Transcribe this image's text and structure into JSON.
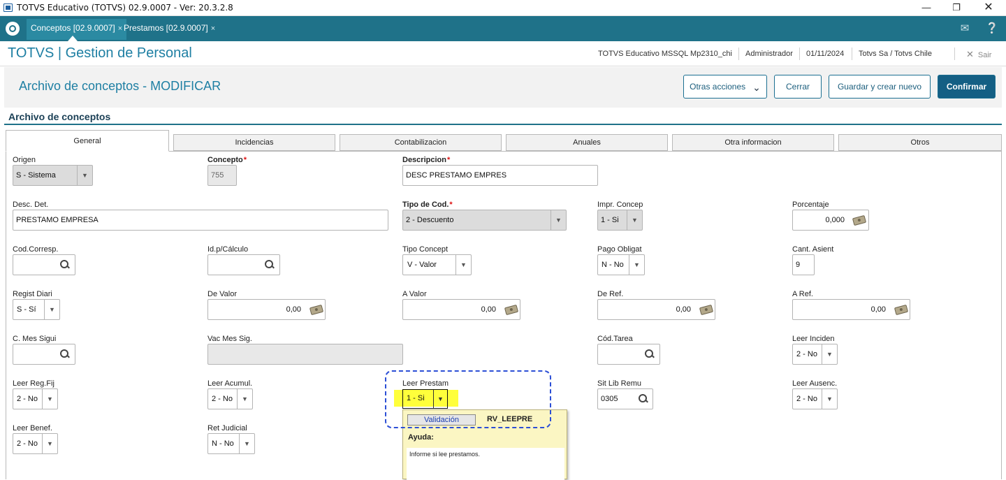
{
  "window": {
    "title": "TOTVS Educativo (TOTVS) 02.9.0007 - Ver: 20.3.2.8"
  },
  "tabs": [
    {
      "label": "Conceptos [02.9.0007]",
      "close": "×"
    },
    {
      "label": "Prestamos [02.9.0007]",
      "close": "×"
    }
  ],
  "app": {
    "title": "TOTVS | Gestion de Personal",
    "environment": "TOTVS Educativo MSSQL Mp2310_chi",
    "user": "Administrador",
    "date": "01/11/2024",
    "company": "Totvs Sa / Totvs Chile",
    "exit_label": "Sair"
  },
  "page": {
    "title": "Archivo de conceptos - MODIFICAR",
    "buttons": {
      "more_actions": "Otras acciones",
      "close": "Cerrar",
      "save_new": "Guardar y crear nuevo",
      "confirm": "Confirmar"
    },
    "section_title": "Archivo de conceptos"
  },
  "folders": [
    "General",
    "Incidencias",
    "Contabilizacion",
    "Anuales",
    "Otra informacion",
    "Otros"
  ],
  "fields": {
    "origen": {
      "label": "Origen",
      "value": "S - Sistema"
    },
    "concepto": {
      "label": "Concepto",
      "value": "755"
    },
    "descripcion": {
      "label": "Descripcion",
      "value": "DESC PRESTAMO EMPRES"
    },
    "desc_det": {
      "label": "Desc. Det.",
      "value": "PRESTAMO EMPRESA"
    },
    "tipo_cod": {
      "label": "Tipo de Cod.",
      "value": "2 - Descuento"
    },
    "impr_concep": {
      "label": "Impr. Concep",
      "value": "1 - Si"
    },
    "porcentaje": {
      "label": "Porcentaje",
      "value": "0,000"
    },
    "cod_corresp": {
      "label": "Cod.Corresp.",
      "value": ""
    },
    "id_calculo": {
      "label": "Id.p/Cálculo",
      "value": ""
    },
    "tipo_concept": {
      "label": "Tipo Concept",
      "value": "V - Valor"
    },
    "pago_oblig": {
      "label": "Pago Obligat",
      "value": "N - No"
    },
    "cant_asient": {
      "label": "Cant. Asient",
      "value": "9"
    },
    "regist_diari": {
      "label": "Regist Diari",
      "value": "S - Sí"
    },
    "de_valor": {
      "label": "De Valor",
      "value": "0,00"
    },
    "a_valor": {
      "label": "A Valor",
      "value": "0,00"
    },
    "de_ref": {
      "label": "De Ref.",
      "value": "0,00"
    },
    "a_ref": {
      "label": "A Ref.",
      "value": "0,00"
    },
    "c_mes_sigui": {
      "label": "C. Mes Sigui",
      "value": ""
    },
    "vac_mes_sig": {
      "label": "Vac Mes Sig.",
      "value": ""
    },
    "cod_tarea": {
      "label": "Cód.Tarea",
      "value": ""
    },
    "leer_inciden": {
      "label": "Leer Inciden",
      "value": "2 - No"
    },
    "leer_reg_fij": {
      "label": "Leer Reg.Fij",
      "value": "2 - No"
    },
    "leer_acumul": {
      "label": "Leer Acumul.",
      "value": "2 - No"
    },
    "leer_prestam": {
      "label": "Leer Prestam",
      "value": "1 - Si"
    },
    "sit_lib_remu": {
      "label": "Sit Lib Remu",
      "value": "0305"
    },
    "leer_ausenc": {
      "label": "Leer Ausenc.",
      "value": "2 - No"
    },
    "leer_benef": {
      "label": "Leer Benef.",
      "value": "2 - No"
    },
    "ret_judicial": {
      "label": "Ret Judicial",
      "value": "N - No"
    }
  },
  "required_mark": "*",
  "tooltip": {
    "validation_label": "Validación",
    "code": "RV_LEEPRE",
    "help_title": "Ayuda:",
    "help_text": "Informe si lee prestamos."
  },
  "colors": {
    "tabstrip": "#1f7289",
    "accent": "#1e7fa3",
    "primary_button": "#145f84",
    "highlight": "#ffff3b",
    "tooltip_bg": "#fbf6c3",
    "dashed_box": "#2c4fd6"
  },
  "icons": [
    "app-window-icon",
    "minimize-icon",
    "restore-icon",
    "close-icon",
    "totvs-logo-icon",
    "mail-icon",
    "help-icon",
    "exit-x-icon",
    "chevron-down-icon",
    "search-icon",
    "money-icon",
    "dropdown-arrow-icon"
  ]
}
